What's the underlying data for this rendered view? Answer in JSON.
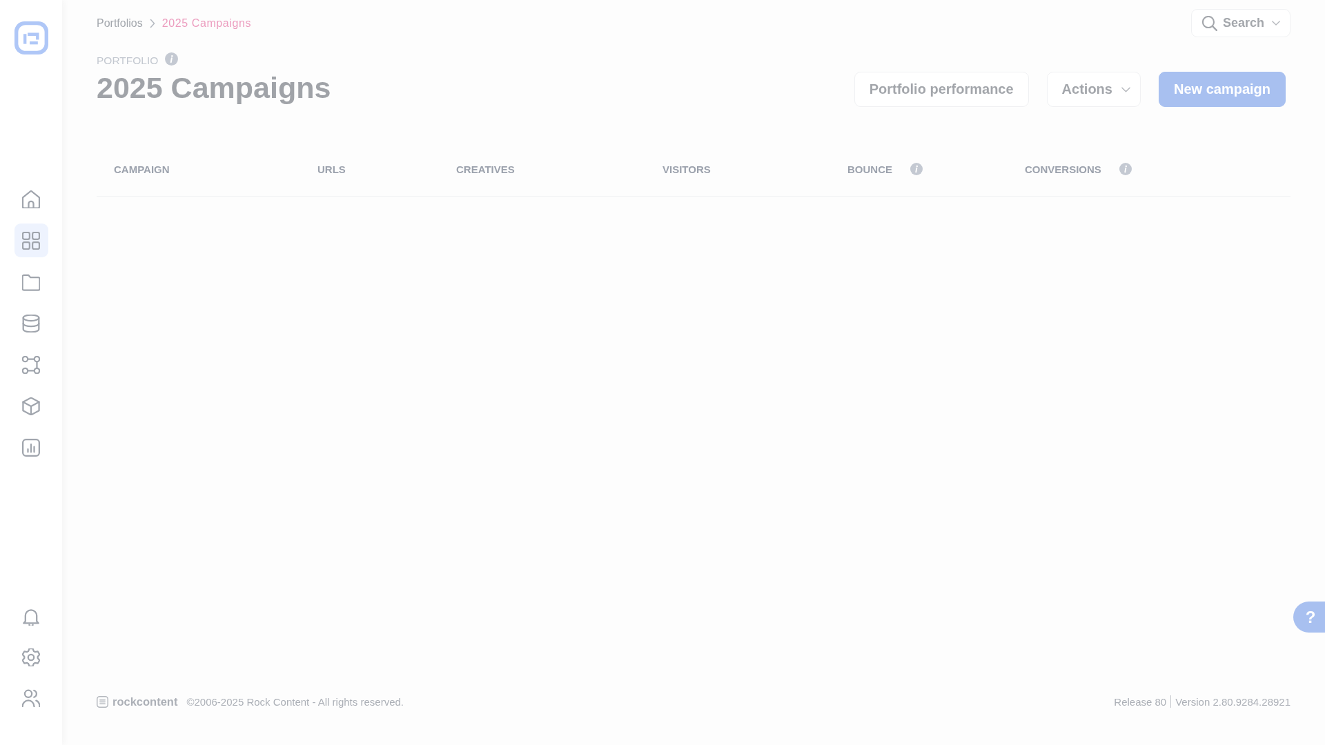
{
  "sidebar": {
    "nav_items": [
      {
        "selected": false
      },
      {
        "selected": true
      },
      {
        "selected": false
      },
      {
        "selected": false
      },
      {
        "selected": false
      },
      {
        "selected": false
      },
      {
        "selected": false
      }
    ],
    "utility_items": [
      {
        "selected": false
      },
      {
        "selected": false
      },
      {
        "selected": false
      }
    ]
  },
  "breadcrumb": [
    {
      "label": "Portfolios",
      "current": false
    },
    {
      "label": "2025 Campaigns",
      "current": true
    }
  ],
  "search_button": {
    "label": "Search"
  },
  "header": {
    "eyebrow": "PORTFOLIO",
    "title": "2025 Campaigns"
  },
  "actions": [
    {
      "label": "Portfolio performance",
      "kind": "secondary"
    },
    {
      "label": "Actions",
      "kind": "dropdown"
    },
    {
      "label": "New campaign",
      "kind": "primary"
    }
  ],
  "table": {
    "columns": [
      {
        "label": "CAMPAIGN",
        "info": false
      },
      {
        "label": "URLS",
        "info": false
      },
      {
        "label": "CREATIVES",
        "info": false
      },
      {
        "label": "VISITORS",
        "info": false
      },
      {
        "label": "BOUNCE",
        "info": true
      },
      {
        "label": "CONVERSIONS",
        "info": true
      }
    ]
  },
  "footer": {
    "brand": "rockcontent",
    "copyright": "©2006-2025 Rock Content - All rights reserved.",
    "release": "Release 80",
    "version": "Version 2.80.9284.28921"
  },
  "help_button": {
    "label": "?"
  }
}
